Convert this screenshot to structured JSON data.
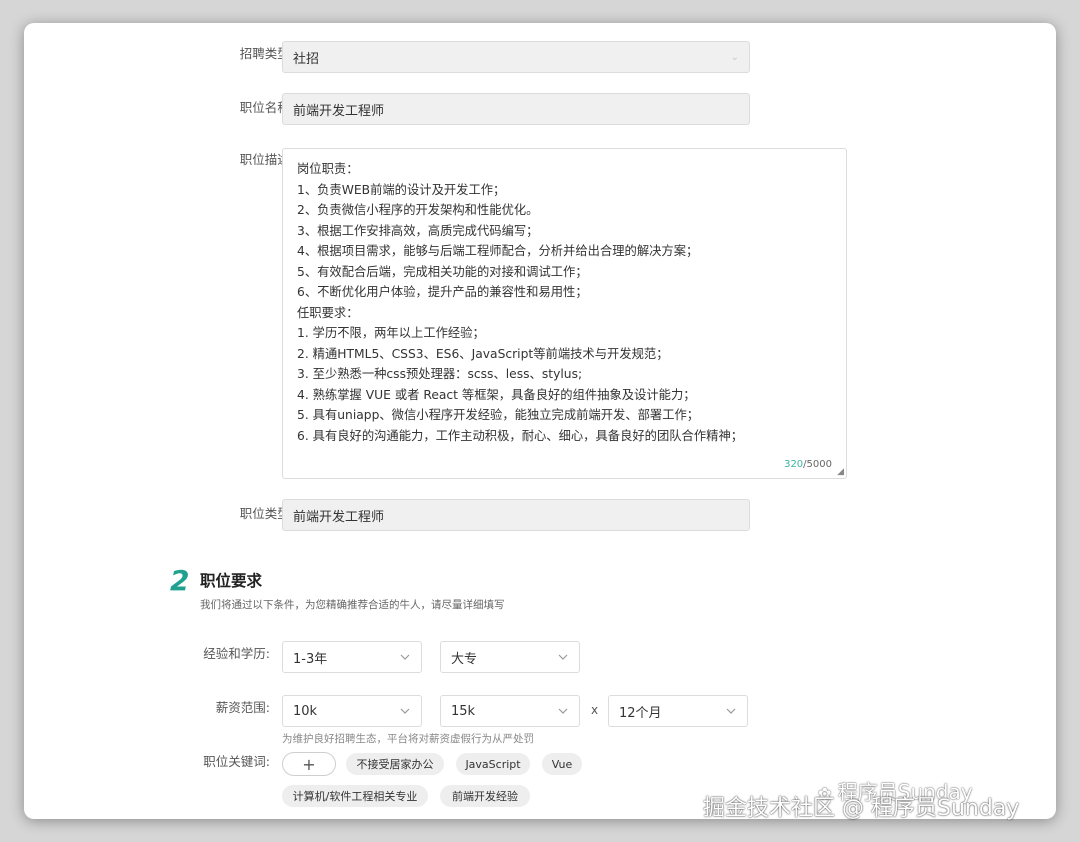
{
  "form": {
    "recruit_type": {
      "label": "招聘类型:",
      "value": "社招"
    },
    "position_name": {
      "label": "职位名称:",
      "value": "前端开发工程师"
    },
    "position_desc": {
      "label": "职位描述:",
      "lines": [
        "岗位职责：",
        "1、负责WEB前端的设计及开发工作；",
        "2、负责微信小程序的开发架构和性能优化。",
        "3、根据工作安排高效，高质完成代码编写；",
        "4、根据项目需求，能够与后端工程师配合，分析并给出合理的解决方案；",
        "5、有效配合后端，完成相关功能的对接和调试工作；",
        "6、不断优化用户体验，提升产品的兼容性和易用性；",
        "任职要求：",
        "1. 学历不限，两年以上工作经验；",
        "2. 精通HTML5、CSS3、ES6、JavaScript等前端技术与开发规范；",
        "3. 至少熟悉一种css预处理器：scss、less、stylus;",
        "4. 熟练掌握 VUE 或者 React 等框架，具备良好的组件抽象及设计能力；",
        "5. 具有uniapp、微信小程序开发经验，能独立完成前端开发、部署工作；",
        "6. 具有良好的沟通能力，工作主动积极，耐心、细心，具备良好的团队合作精神；"
      ],
      "count_current": "320",
      "count_max": "/5000"
    },
    "position_category": {
      "label": "职位类型:",
      "value": "前端开发工程师"
    }
  },
  "section2": {
    "number": "2",
    "title": "职位要求",
    "subtitle": "我们将通过以下条件，为您精确推荐合适的牛人，请尽量详细填写"
  },
  "requirements": {
    "experience_label": "经验和学历:",
    "experience": "1-3年",
    "education": "大专",
    "salary_label": "薪资范围:",
    "salary_min": "10k",
    "salary_max": "15k",
    "times": "x",
    "months": "12个月",
    "salary_hint": "为维护良好招聘生态，平台将对薪资虚假行为从严处罚",
    "keywords_label": "职位关键词:",
    "add_symbol": "+",
    "keywords": [
      "不接受居家办公",
      "JavaScript",
      "Vue",
      "计算机/软件工程相关专业",
      "前端开发经验"
    ]
  },
  "watermark": {
    "line1": "程序员Sunday",
    "line2": "掘金技术社区 @ 程序员Sunday"
  }
}
